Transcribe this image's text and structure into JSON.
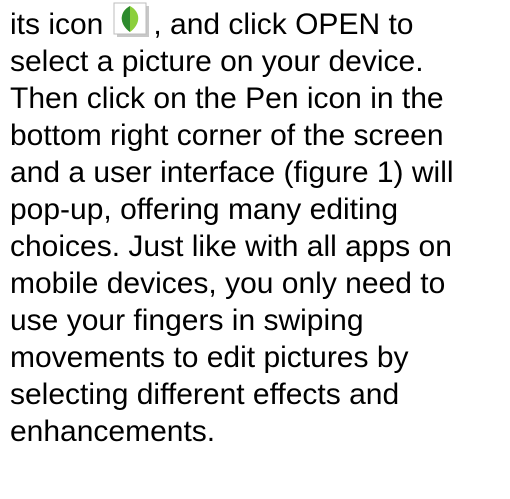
{
  "paragraph": {
    "line1_before_icon": "its icon",
    "icon": {
      "name": "snapseed-app-icon",
      "colors": {
        "leaf_dark": "#2e8b2e",
        "leaf_light": "#8ccf3c",
        "tile": "#ffffff",
        "shadow": "#c8c8c8"
      }
    },
    "line1_after_icon": ", and click OPEN to",
    "lines": [
      "select a picture on your device.",
      "Then click on the Pen icon in the",
      "bottom right corner of the screen",
      "and a user interface (figure 1) will",
      "pop-up, offering many editing",
      "choices.  Just like with all apps on",
      "mobile devices, you only need to",
      "use your fingers in swiping",
      "movements to edit pictures by",
      "selecting different effects and",
      "enhancements."
    ]
  }
}
